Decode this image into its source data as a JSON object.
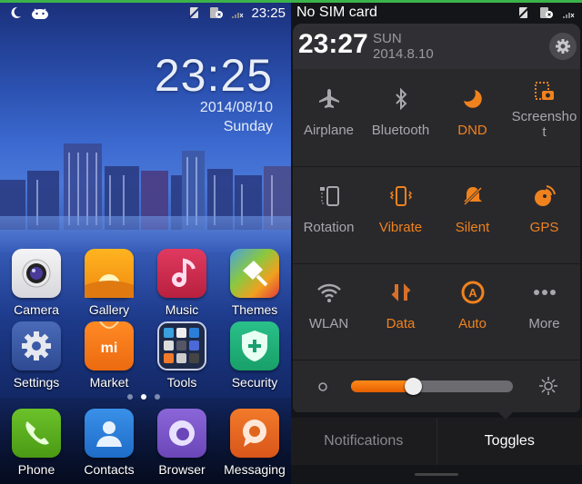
{
  "home": {
    "status": {
      "time": "23:25",
      "left_icons": [
        "moon-icon",
        "android-icon"
      ],
      "right_icons": [
        "vibrate-off-icon",
        "sim-missing-icon",
        "signal-none-icon"
      ]
    },
    "clock": {
      "time": "23:25",
      "date": "2014/08/10",
      "day": "Sunday"
    },
    "rows": [
      [
        {
          "label": "Camera",
          "icon": "camera-icon",
          "color": "#e8e8ea"
        },
        {
          "label": "Gallery",
          "icon": "gallery-icon",
          "color": "#f5a623"
        },
        {
          "label": "Music",
          "icon": "music-icon",
          "color": "#d02a4e"
        },
        {
          "label": "Themes",
          "icon": "themes-icon",
          "color": "#7fbf3f"
        }
      ],
      [
        {
          "label": "Settings",
          "icon": "settings-icon",
          "color": "#3a5aa8"
        },
        {
          "label": "Market",
          "icon": "market-icon",
          "color": "#f27a1a"
        },
        {
          "label": "Tools",
          "icon": "tools-folder-icon",
          "color": "#1e2a48"
        },
        {
          "label": "Security",
          "icon": "security-icon",
          "color": "#22b07a"
        }
      ]
    ],
    "page_indicator": {
      "count": 3,
      "current": 2
    },
    "dock": [
      {
        "label": "Phone",
        "icon": "phone-icon",
        "color": "#5caa1e"
      },
      {
        "label": "Contacts",
        "icon": "contacts-icon",
        "color": "#2a7fd8"
      },
      {
        "label": "Browser",
        "icon": "browser-icon",
        "color": "#7a56c8"
      },
      {
        "label": "Messaging",
        "icon": "messaging-icon",
        "color": "#e8601c"
      }
    ]
  },
  "shade": {
    "status": {
      "carrier": "No SIM card"
    },
    "header": {
      "time": "23:27",
      "day": "SUN",
      "date": "2014.8.10"
    },
    "toggles": [
      [
        {
          "label": "Airplane",
          "icon": "airplane-icon",
          "on": false
        },
        {
          "label": "Bluetooth",
          "icon": "bluetooth-icon",
          "on": false
        },
        {
          "label": "DND",
          "icon": "moon-icon",
          "on": true
        },
        {
          "label": "Screenshot",
          "icon": "screenshot-icon",
          "on": true
        }
      ],
      [
        {
          "label": "Rotation",
          "icon": "rotation-lock-icon",
          "on": false
        },
        {
          "label": "Vibrate",
          "icon": "vibrate-icon",
          "on": true
        },
        {
          "label": "Silent",
          "icon": "silent-icon",
          "on": true
        },
        {
          "label": "GPS",
          "icon": "gps-icon",
          "on": true
        }
      ],
      [
        {
          "label": "WLAN",
          "icon": "wifi-icon",
          "on": false
        },
        {
          "label": "Data",
          "icon": "data-icon",
          "on": true
        },
        {
          "label": "Auto",
          "icon": "auto-brightness-icon",
          "on": true
        },
        {
          "label": "More",
          "icon": "more-icon",
          "on": false
        }
      ]
    ],
    "brightness": {
      "value_percent": 38
    },
    "tabs": [
      {
        "label": "Notifications",
        "active": false
      },
      {
        "label": "Toggles",
        "active": true
      }
    ],
    "colors": {
      "accent": "#f0821e",
      "inactive": "#a8a8ac"
    }
  }
}
